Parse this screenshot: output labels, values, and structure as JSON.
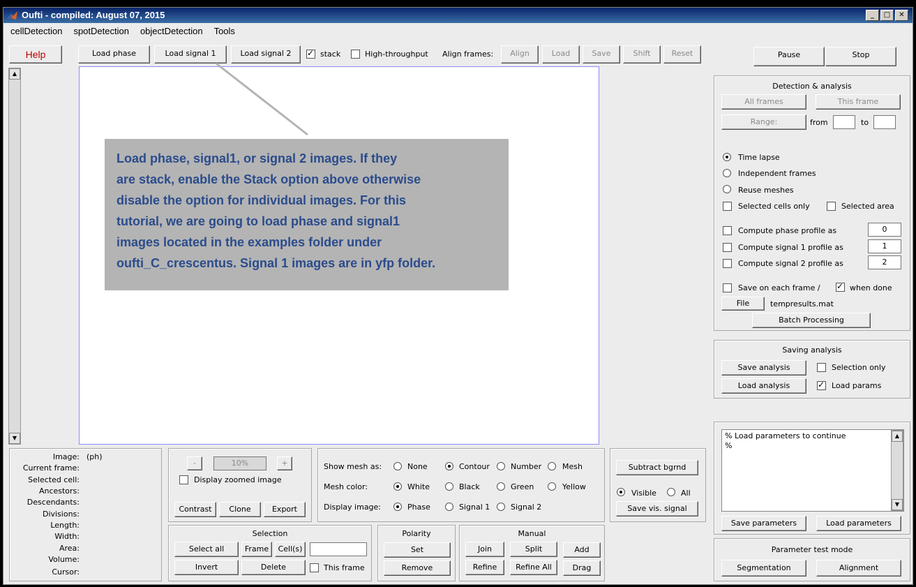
{
  "window": {
    "title": "Oufti - compiled:  August 07, 2015"
  },
  "menu": [
    "cellDetection",
    "spotDetection",
    "objectDetection",
    "Tools"
  ],
  "toolbar": {
    "help": "Help",
    "load_phase": "Load phase",
    "load_signal1": "Load signal 1",
    "load_signal2": "Load signal 2",
    "stack": "stack",
    "high_throughput": "High-throughput",
    "align_frames": "Align frames:",
    "align": "Align",
    "load": "Load",
    "save": "Save",
    "shift": "Shift",
    "reset": "Reset",
    "pause": "Pause",
    "stop": "Stop"
  },
  "callout": {
    "lines": [
      "Load phase, signal1, or signal 2 images.  If they",
      "are stack, enable the Stack option above otherwise",
      "disable the option for individual images.  For this",
      "tutorial, we are going to load phase and signal1",
      "images located in the examples folder under",
      "oufti_C_crescentus.  Signal 1 images are in yfp folder."
    ]
  },
  "detection": {
    "title": "Detection & analysis",
    "all_frames": "All frames",
    "this_frame": "This frame",
    "range": "Range:",
    "from": "from",
    "to": "to",
    "time_lapse": "Time lapse",
    "independent_frames": "Independent frames",
    "reuse_meshes": "Reuse meshes",
    "selected_cells_only": "Selected cells only",
    "selected_area": "Selected area",
    "compute_phase": "Compute phase profile as",
    "compute_phase_val": "0",
    "compute_signal1": "Compute signal 1 profile as",
    "compute_signal1_val": "1",
    "compute_signal2": "Compute signal 2 profile as",
    "compute_signal2_val": "2",
    "save_each_frame": "Save on each frame /",
    "when_done": "when done",
    "file": "File",
    "filename": "tempresults.mat",
    "batch": "Batch Processing"
  },
  "saving": {
    "title": "Saving analysis",
    "save_analysis": "Save analysis",
    "selection_only": "Selection only",
    "load_analysis": "Load analysis",
    "load_params": "Load params"
  },
  "params": {
    "log_lines": [
      "% Load parameters to continue",
      "%"
    ],
    "save_parameters": "Save parameters",
    "load_parameters": "Load parameters",
    "test_mode_title": "Parameter test mode",
    "segmentation": "Segmentation",
    "alignment": "Alignment"
  },
  "info": {
    "labels": [
      "Image:",
      "Current frame:",
      "Selected cell:",
      "Ancestors:",
      "Descendants:",
      "Divisions:",
      "Length:",
      "Width:",
      "Area:",
      "Volume:",
      "Cursor:"
    ],
    "image_value": "(ph)"
  },
  "zoom": {
    "minus": "-",
    "value": "10%",
    "plus": "+",
    "display_zoomed": "Display zoomed image",
    "contrast": "Contrast",
    "clone": "Clone",
    "export": "Export"
  },
  "display": {
    "show_mesh_as": "Show mesh as:",
    "mesh_opts": [
      "None",
      "Contour",
      "Number",
      "Mesh"
    ],
    "mesh_color": "Mesh color:",
    "color_opts": [
      "White",
      "Black",
      "Green",
      "Yellow"
    ],
    "display_image": "Display image:",
    "image_opts": [
      "Phase",
      "Signal 1",
      "Signal 2"
    ]
  },
  "bgrnd": {
    "subtract": "Subtract bgrnd",
    "visible": "Visible",
    "all": "All",
    "save_vis": "Save vis. signal"
  },
  "selection": {
    "title": "Selection",
    "select_all": "Select all",
    "frame": "Frame",
    "cells": "Cell(s)",
    "invert": "Invert",
    "delete": "Delete",
    "this_frame": "This frame"
  },
  "polarity": {
    "title": "Polarity",
    "set": "Set",
    "remove": "Remove"
  },
  "manual": {
    "title": "Manual",
    "join": "Join",
    "split": "Split",
    "add": "Add",
    "refine": "Refine",
    "refine_all": "Refine All",
    "drag": "Drag"
  }
}
